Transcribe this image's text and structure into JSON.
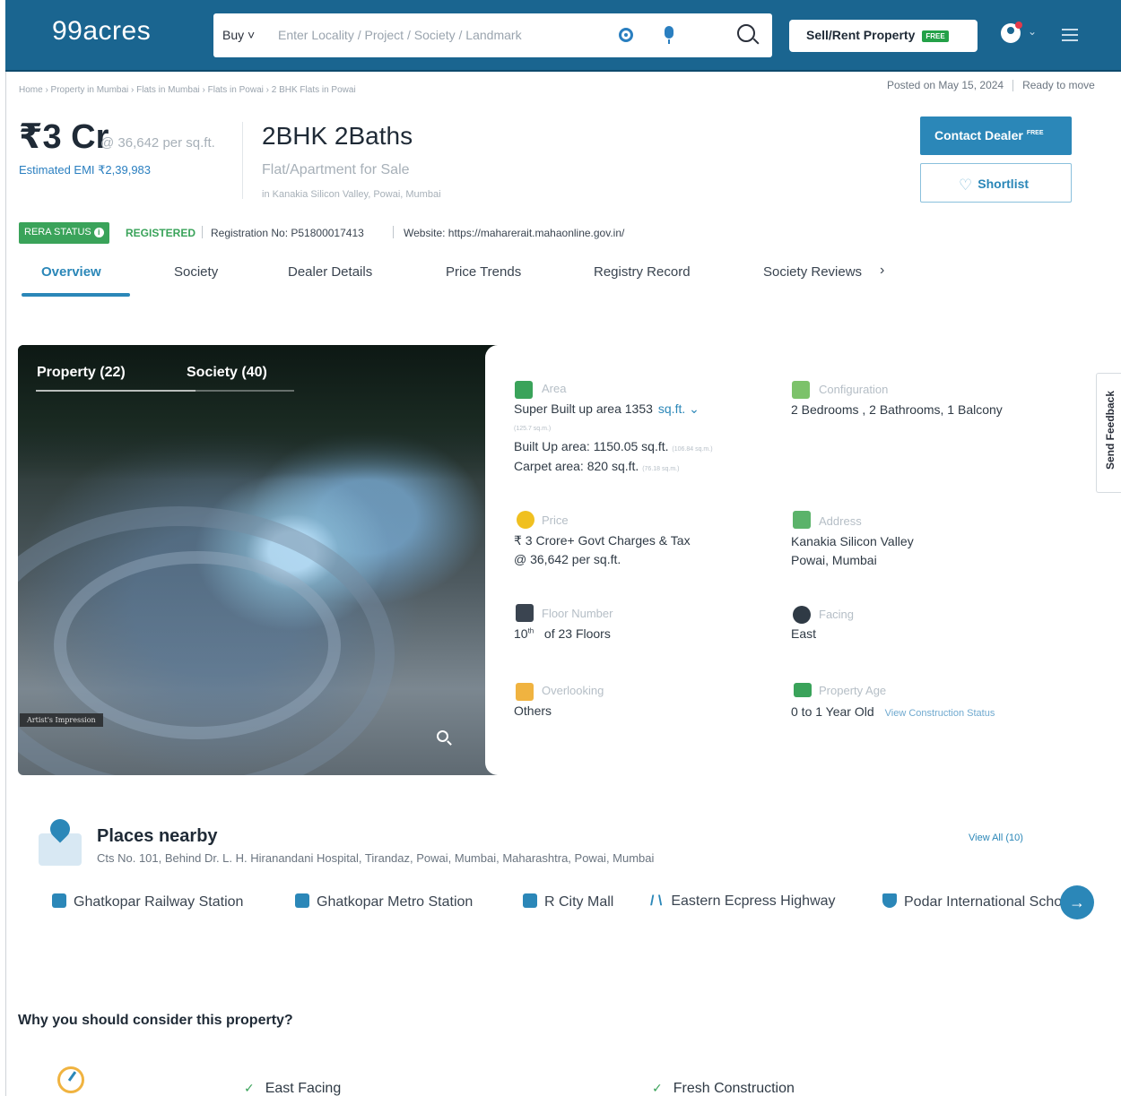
{
  "header": {
    "logo": "99acres",
    "buy_label": "Buy ˅",
    "search_placeholder": "Enter Locality / Project / Society / Landmark",
    "sell_label": "Sell/Rent Property",
    "free_badge": "FREE"
  },
  "breadcrumb": "Home › Property in Mumbai › Flats in Mumbai › Flats in Powai › 2 BHK Flats in Powai",
  "posted": {
    "date": "Posted on May 15, 2024",
    "status": "Ready to move"
  },
  "listing": {
    "price": "₹3 Cr",
    "price_per_sqft": "@ 36,642 per sq.ft.",
    "emi": "Estimated EMI ₹2,39,983",
    "title": "2BHK 2Baths",
    "subtitle": "Flat/Apartment for Sale",
    "location": "in Kanakia Silicon Valley, Powai, Mumbai",
    "contact_label": "Contact Dealer",
    "contact_badge": "FREE",
    "shortlist_label": "Shortlist"
  },
  "rera": {
    "badge": "RERA STATUS",
    "status": "REGISTERED",
    "registration": "Registration No: P51800017413",
    "website": "Website: https://maharerait.mahaonline.gov.in/"
  },
  "tabs": [
    "Overview",
    "Society",
    "Dealer Details",
    "Price Trends",
    "Registry Record",
    "Society Reviews"
  ],
  "gallery": {
    "tab_property": "Property (22)",
    "tab_society": "Society (40)",
    "impression": "Artist's Impression"
  },
  "specs": {
    "area_label": "Area",
    "super_built": "Super Built up area 1353",
    "sqft_unit": "sq.ft.",
    "super_sqm": "(125.7 sq.m.)",
    "built_up": "Built Up area: 1150.05 sq.ft.",
    "built_sqm": "(106.84 sq.m.)",
    "carpet": "Carpet area: 820 sq.ft.",
    "carpet_sqm": "(76.18 sq.m.)",
    "config_label": "Configuration",
    "config_value": "2 Bedrooms , 2 Bathrooms, 1 Balcony",
    "price_label": "Price",
    "price_value": "₹ 3 Crore+ Govt Charges & Tax",
    "price_sqft": "@ 36,642 per sq.ft.",
    "address_label": "Address",
    "address_line1": "Kanakia Silicon Valley",
    "address_line2": "Powai, Mumbai",
    "floor_label": "Floor Number",
    "floor_value": "10",
    "floor_suffix": "th",
    "floor_total": "of 23 Floors",
    "facing_label": "Facing",
    "facing_value": "East",
    "overlooking_label": "Overlooking",
    "overlooking_value": "Others",
    "age_label": "Property Age",
    "age_value": "0 to 1 Year Old",
    "construction_link": "View Construction Status"
  },
  "feedback_label": "Send Feedback",
  "places": {
    "title": "Places nearby",
    "address": "Cts No. 101, Behind Dr. L. H. Hiranandani Hospital, Tirandaz, Powai, Mumbai, Maharashtra, Powai, Mumbai",
    "view_all": "View All (10)",
    "items": [
      "Ghatkopar Railway Station",
      "Ghatkopar Metro Station",
      "R City Mall",
      "Eastern Ecpress Highway",
      "Podar International School"
    ]
  },
  "why": {
    "title": "Why you should consider this property?",
    "items": [
      "East Facing",
      "Fresh Construction"
    ]
  }
}
